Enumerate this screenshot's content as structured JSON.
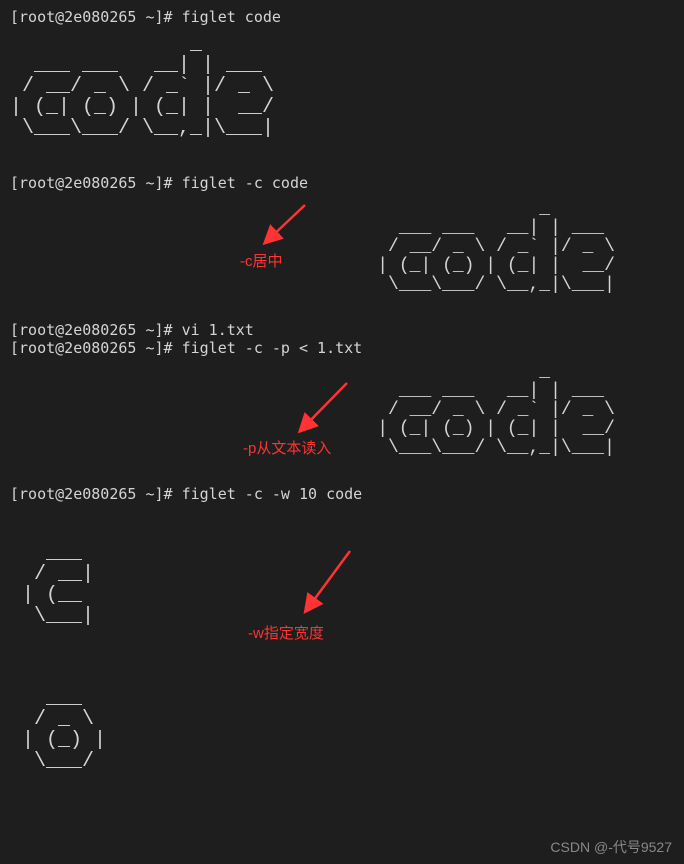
{
  "lines": {
    "prompt1": "[root@2e080265 ~]# figlet code",
    "prompt2": "[root@2e080265 ~]# figlet -c code",
    "prompt3": "[root@2e080265 ~]# vi 1.txt",
    "prompt4": "[root@2e080265 ~]# figlet -c -p < 1.txt",
    "prompt5": "[root@2e080265 ~]# figlet -c -w 10 code"
  },
  "ascii": {
    "code1": "               _      \n  ___ ___   __| | ___ \n / __/ _ \\ / _` |/ _ \\\n| (_| (_) | (_| |  __/\n \\___\\___/ \\__,_|\\___|\n                      ",
    "code_centered": "                                                 _      \n                                    ___ ___   __| | ___ \n                                   / __/ _ \\ / _` |/ _ \\\n                                  | (_| (_) | (_| |  __/\n                                   \\___\\___/ \\__,_|\\___|\n                                                        ",
    "code_p": "                                                 _      \n                                    ___ ___   __| | ___ \n                                   / __/ _ \\ / _` |/ _ \\\n                                  | (_| (_) | (_| |  __/\n                                   \\___\\___/ \\__,_|\\___|\n                                                        ",
    "c_letter": "  ___ \n / __|\n| (__ \n \\___|\n      ",
    "o_letter": "  ___  \n / _ \\ \n| (_) |\n \\___/ \n       "
  },
  "annotations": {
    "c_center": "-c居中",
    "p_read": "-p从文本读入",
    "w_width": "-w指定宽度"
  },
  "watermark": "CSDN @-代号9527"
}
